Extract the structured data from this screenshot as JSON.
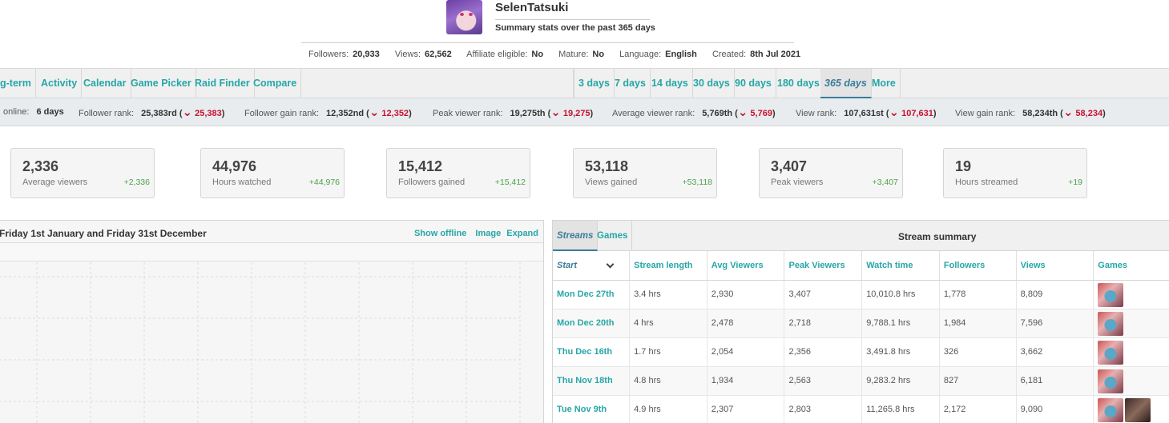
{
  "profile": {
    "username": "SelenTatsuki",
    "subtitle": "Summary stats over the past 365 days",
    "info": [
      {
        "label": "Followers:",
        "value": "20,933"
      },
      {
        "label": "Views:",
        "value": "62,562"
      },
      {
        "label": "Affiliate eligible:",
        "value": "No"
      },
      {
        "label": "Mature:",
        "value": "No"
      },
      {
        "label": "Language:",
        "value": "English"
      },
      {
        "label": "Created:",
        "value": "8th Jul 2021"
      }
    ]
  },
  "nav": {
    "left": [
      "g-term",
      "Activity",
      "Calendar",
      "Game Picker",
      "Raid Finder",
      "Compare"
    ],
    "right": [
      "3 days",
      "7 days",
      "14 days",
      "30 days",
      "90 days",
      "180 days",
      "365 days",
      "More"
    ],
    "active": "365 days"
  },
  "ranks": [
    {
      "label": "online:",
      "value": "6 days",
      "delta": ""
    },
    {
      "label": "Follower rank:",
      "value": "25,383rd",
      "delta": "25,383"
    },
    {
      "label": "Follower gain rank:",
      "value": "12,352nd",
      "delta": "12,352"
    },
    {
      "label": "Peak viewer rank:",
      "value": "19,275th",
      "delta": "19,275"
    },
    {
      "label": "Average viewer rank:",
      "value": "5,769th",
      "delta": "5,769"
    },
    {
      "label": "View rank:",
      "value": "107,631st",
      "delta": "107,631"
    },
    {
      "label": "View gain rank:",
      "value": "58,234th",
      "delta": "58,234"
    }
  ],
  "cards": [
    {
      "value": "2,336",
      "label": "Average viewers",
      "delta": "+2,336"
    },
    {
      "value": "44,976",
      "label": "Hours watched",
      "delta": "+44,976"
    },
    {
      "value": "15,412",
      "label": "Followers gained",
      "delta": "+15,412"
    },
    {
      "value": "53,118",
      "label": "Views gained",
      "delta": "+53,118"
    },
    {
      "value": "3,407",
      "label": "Peak viewers",
      "delta": "+3,407"
    },
    {
      "value": "19",
      "label": "Hours streamed",
      "delta": "+19"
    }
  ],
  "chart_panel": {
    "title": "Friday 1st January and Friday 31st December",
    "show_offline": "Show offline",
    "image": "Image",
    "expand": "Expand"
  },
  "streams": {
    "tabs": [
      "Streams",
      "Games"
    ],
    "title": "Stream summary",
    "columns": [
      "Start",
      "Stream length",
      "Avg Viewers",
      "Peak Viewers",
      "Watch time",
      "Followers",
      "Views",
      "Games"
    ],
    "rows": [
      {
        "start": "Mon Dec 27th",
        "length": "3.4 hrs",
        "avg": "2,930",
        "peak": "3,407",
        "watch": "10,010.8 hrs",
        "followers": "1,778",
        "views": "8,809",
        "games": 1
      },
      {
        "start": "Mon Dec 20th",
        "length": "4 hrs",
        "avg": "2,478",
        "peak": "2,718",
        "watch": "9,788.1 hrs",
        "followers": "1,984",
        "views": "7,596",
        "games": 1
      },
      {
        "start": "Thu Dec 16th",
        "length": "1.7 hrs",
        "avg": "2,054",
        "peak": "2,356",
        "watch": "3,491.8 hrs",
        "followers": "326",
        "views": "3,662",
        "games": 1
      },
      {
        "start": "Thu Nov 18th",
        "length": "4.8 hrs",
        "avg": "1,934",
        "peak": "2,563",
        "watch": "9,283.2 hrs",
        "followers": "827",
        "views": "6,181",
        "games": 1
      },
      {
        "start": "Tue Nov 9th",
        "length": "4.9 hrs",
        "avg": "2,307",
        "peak": "2,803",
        "watch": "11,265.8 hrs",
        "followers": "2,172",
        "views": "9,090",
        "games": 2
      }
    ]
  },
  "colors": {
    "accent": "#27a6a6",
    "active_tab": "#3a7c9a",
    "rank_down": "#c8102e",
    "delta_up": "#4aa34a"
  }
}
